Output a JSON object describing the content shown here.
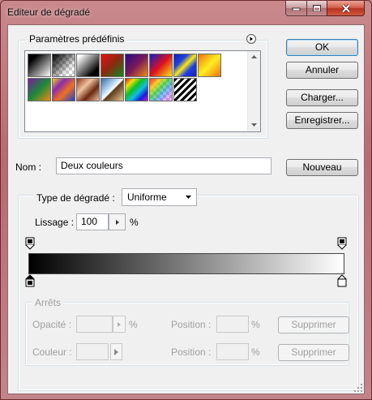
{
  "window": {
    "title": "Editeur de dégradé"
  },
  "presets": {
    "label": "Paramètres prédéfinis",
    "swatches": [
      {
        "name": "black-white"
      },
      {
        "name": "black-transparent"
      },
      {
        "name": "white-black"
      },
      {
        "name": "red-green"
      },
      {
        "name": "violet-orange"
      },
      {
        "name": "blue-red-yellow"
      },
      {
        "name": "blue-yellow-blue"
      },
      {
        "name": "orange-yellow-orange"
      },
      {
        "name": "violet-green-orange"
      },
      {
        "name": "yellow-violet-orange-blue"
      },
      {
        "name": "copper"
      },
      {
        "name": "chrome"
      },
      {
        "name": "spectrum"
      },
      {
        "name": "transparent-rainbow"
      },
      {
        "name": "transparent-stripes"
      }
    ]
  },
  "buttons": {
    "ok": "OK",
    "cancel": "Annuler",
    "load": "Charger...",
    "save": "Enregistrer...",
    "new": "Nouveau",
    "delete_opacity": "Supprimer",
    "delete_color": "Supprimer"
  },
  "name_field": {
    "label": "Nom :",
    "value": "Deux couleurs"
  },
  "gradient": {
    "type_label": "Type de dégradé :",
    "type_value": "Uniforme",
    "smoothness_label": "Lissage :",
    "smoothness_value": "100",
    "smoothness_unit": "%",
    "start_color": "#000000",
    "end_color": "#ffffff"
  },
  "stops": {
    "label": "Arrêts",
    "opacity_label": "Opacité :",
    "opacity_value": "",
    "opacity_unit": "%",
    "position_label_1": "Position :",
    "position_value_1": "",
    "position_unit_1": "%",
    "color_label": "Couleur :",
    "position_label_2": "Position :",
    "position_value_2": "",
    "position_unit_2": "%"
  }
}
